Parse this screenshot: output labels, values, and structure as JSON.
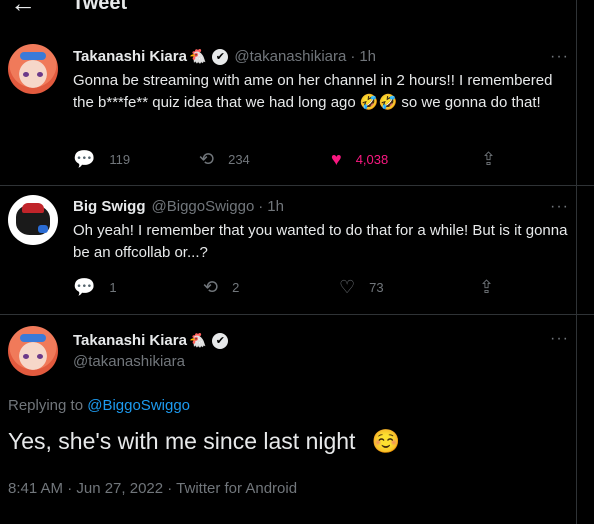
{
  "header": {
    "back_icon": "←",
    "title": "Tweet"
  },
  "tweets": [
    {
      "display_name": "Takanashi Kiara",
      "name_emoji": "🐔",
      "verified_icon": "✔",
      "handle": "@takanashikiara",
      "separator": "·",
      "time": "1h",
      "more_icon": "···",
      "text": "Gonna be streaming with ame on her channel in 2 hours!! I remembered the b***fe** quiz idea that we had long ago 🤣🤣 so we gonna do that!",
      "replies": "119",
      "retweets": "234",
      "likes": "4,038",
      "reply_icon": "💬",
      "retweet_icon": "⟲",
      "like_icon": "♥",
      "share_icon": "⇪"
    },
    {
      "display_name": "Big Swigg",
      "handle": "@BiggoSwiggo",
      "separator": "·",
      "time": "1h",
      "more_icon": "···",
      "text": "Oh yeah! I remember that you wanted to do that for a while! But is it gonna be an offcollab or...?",
      "replies": "1",
      "retweets": "2",
      "likes": "73",
      "reply_icon": "💬",
      "retweet_icon": "⟲",
      "like_icon": "♡",
      "share_icon": "⇪"
    }
  ],
  "main": {
    "display_name": "Takanashi Kiara",
    "name_emoji": "🐔",
    "verified_icon": "✔",
    "handle": "@takanashikiara",
    "more_icon": "···",
    "replying_prefix": "Replying to",
    "replying_to": "@BiggoSwiggo",
    "text": "Yes, she's with me since last night",
    "text_emoji": "☺️",
    "timestamp": "8:41 AM · Jun 27, 2022 · Twitter for Android"
  }
}
